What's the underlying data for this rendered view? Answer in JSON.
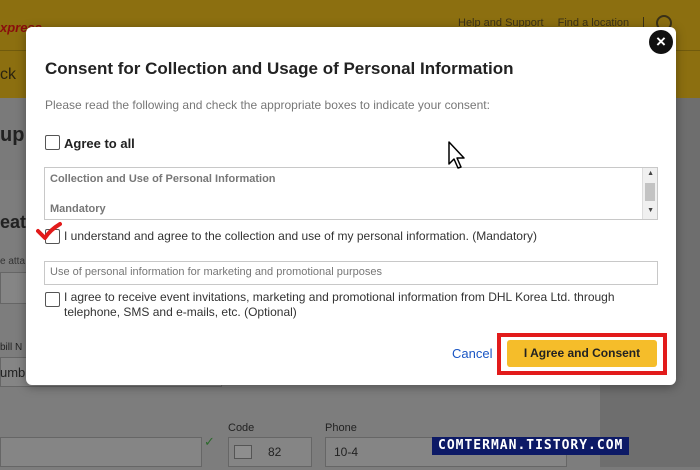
{
  "background": {
    "brand": "xpress",
    "top_links": [
      "Help and Support",
      "Find a location"
    ],
    "back": "ck",
    "page_title": "up",
    "section_title": "eate",
    "small_text": "e atta",
    "waybill_label": "bill N",
    "waybill_value": "umb",
    "code_label": "Code",
    "code_value": "82",
    "phone_label": "Phone",
    "phone_value": "10-4"
  },
  "modal": {
    "title": "Consent for Collection and Usage of Personal Information",
    "description": "Please read the following and check the appropriate boxes to indicate your consent:",
    "agree_all": "Agree to all",
    "scroll_box": {
      "title": "Collection and Use of Personal Information",
      "subtitle": "Mandatory"
    },
    "mandatory_label": "I understand and agree to the collection and use of my personal information. (Mandatory)",
    "marketing_title": "Use of personal information for marketing and promotional purposes",
    "optional_label": "I agree to receive event invitations, marketing and promotional information from DHL Korea Ltd. through telephone, SMS and e-mails, etc. (Optional)",
    "cancel": "Cancel",
    "agree_button": "I Agree and Consent"
  },
  "watermark": "COMTERMAN.TISTORY.COM",
  "colors": {
    "agree_button": "#f5bd2a",
    "highlight": "#e21b1b",
    "cancel_link": "#1a56c4"
  }
}
